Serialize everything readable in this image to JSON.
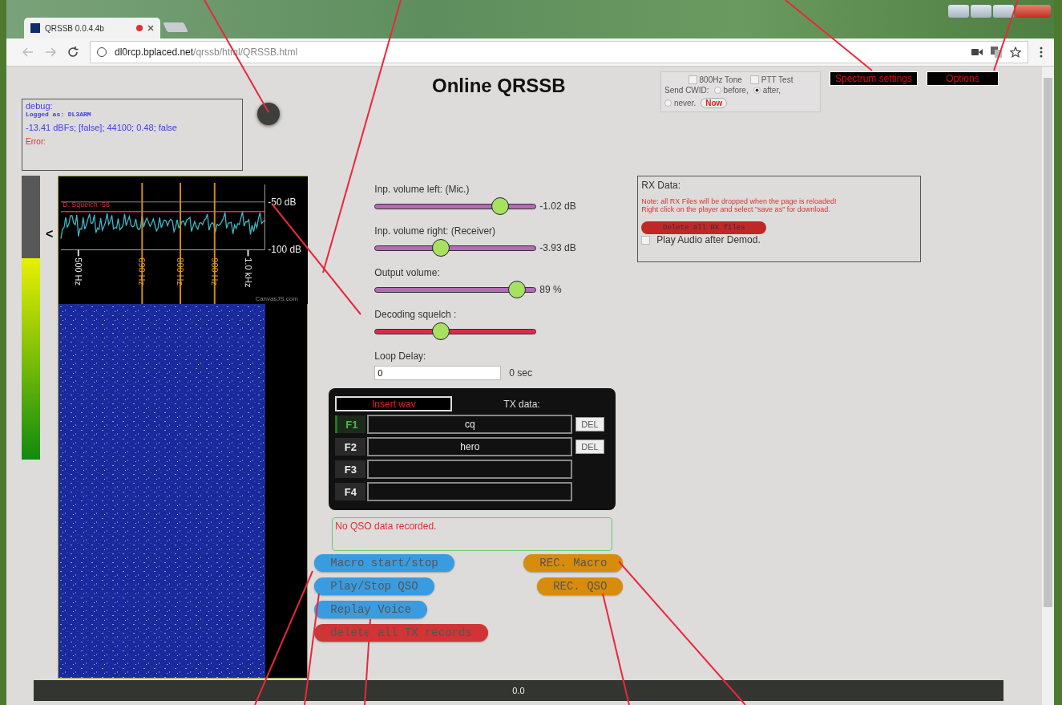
{
  "browser": {
    "tab_title": "QRSSB 0.0.4.4b",
    "url": "**dl0rcp.bplaced.net**/qrssb/html/QRSSB.html"
  },
  "page_title": "Online QRSSB",
  "debug": {
    "heading": "debug:",
    "logged_as": "Logged as: DL3ARM",
    "status": "-13.41 dBFs; [false]; 44100; 0.48; false",
    "error": "Error:"
  },
  "options_box": {
    "checkboxes": [
      {
        "label": "800Hz Tone",
        "checked": false
      },
      {
        "label": "PTT Test",
        "checked": false
      }
    ],
    "cwid_label": "Send CWID:",
    "radios": [
      {
        "label": "before,",
        "selected": false
      },
      {
        "label": "after,",
        "selected": true
      },
      {
        "label": "never.",
        "selected": false
      }
    ],
    "now_button": "Now"
  },
  "top_buttons": [
    "Spectrum settings",
    "Options"
  ],
  "level_meter": {
    "level": 0.71,
    "arrow": "<"
  },
  "spectrum": {
    "squelch_label": "D. Squelch -58",
    "db_labels": [
      "-50 dB",
      "-100 dB"
    ],
    "freq_labels": [
      {
        "label": "500 Hz",
        "marker": false
      },
      {
        "label": "690 Hz",
        "marker": true
      },
      {
        "label": "800 Hz",
        "marker": true
      },
      {
        "label": "900 Hz",
        "marker": true
      },
      {
        "label": "1.0 kHz",
        "marker": false
      }
    ],
    "credit": "CanvasJS.com"
  },
  "sliders": [
    {
      "label": "Inp. volume left: (Mic.)",
      "level": 0.75,
      "reading": "-1.02 dB",
      "kind": "volume"
    },
    {
      "label": "Inp. volume right: (Receiver)",
      "level": 0.42,
      "reading": "-3.93 dB",
      "kind": "volume"
    },
    {
      "label": "Output volume:",
      "level": 0.84,
      "reading": "89 %",
      "kind": "volume"
    },
    {
      "label": "Decoding squelch :",
      "level": 0.42,
      "kind": "squelch"
    }
  ],
  "loop_delay": {
    "label": "Loop Delay:",
    "value": "0",
    "unit": "0 sec"
  },
  "tx": {
    "insert_button": "Insert wav",
    "heading": "TX data:",
    "rows": [
      {
        "key": "F1",
        "value": "cq",
        "selected": true,
        "delete": "DEL"
      },
      {
        "key": "F2",
        "value": "hero",
        "selected": false,
        "delete": "DEL"
      },
      {
        "key": "F3",
        "selected": false
      },
      {
        "key": "F4",
        "selected": false
      }
    ]
  },
  "qso_log": "No QSO data recorded.",
  "left_buttons": [
    {
      "label": "Macro start/stop",
      "color": "#3a9ce0"
    },
    {
      "label": "Play/Stop QSO",
      "color": "#3a9ce0"
    },
    {
      "label": "Replay Voice",
      "color": "#3a9ce0"
    },
    {
      "label": "delete all TX records",
      "color": "#d03434"
    }
  ],
  "right_buttons": [
    {
      "label": "REC. Macro",
      "color": "#d88c0c"
    },
    {
      "label": "REC. QSO",
      "color": "#d88c0c"
    }
  ],
  "rx": {
    "heading": "RX Data:",
    "notes": [
      "Note: all RX Files will be dropped when the page is reloaded!",
      "Right click on the player and select \"save as\" for download."
    ],
    "delete_button": "Delete all RX files",
    "play_audio": {
      "label": "Play Audio after Demod.",
      "checked": false
    }
  },
  "progress": {
    "text": "0.0"
  }
}
